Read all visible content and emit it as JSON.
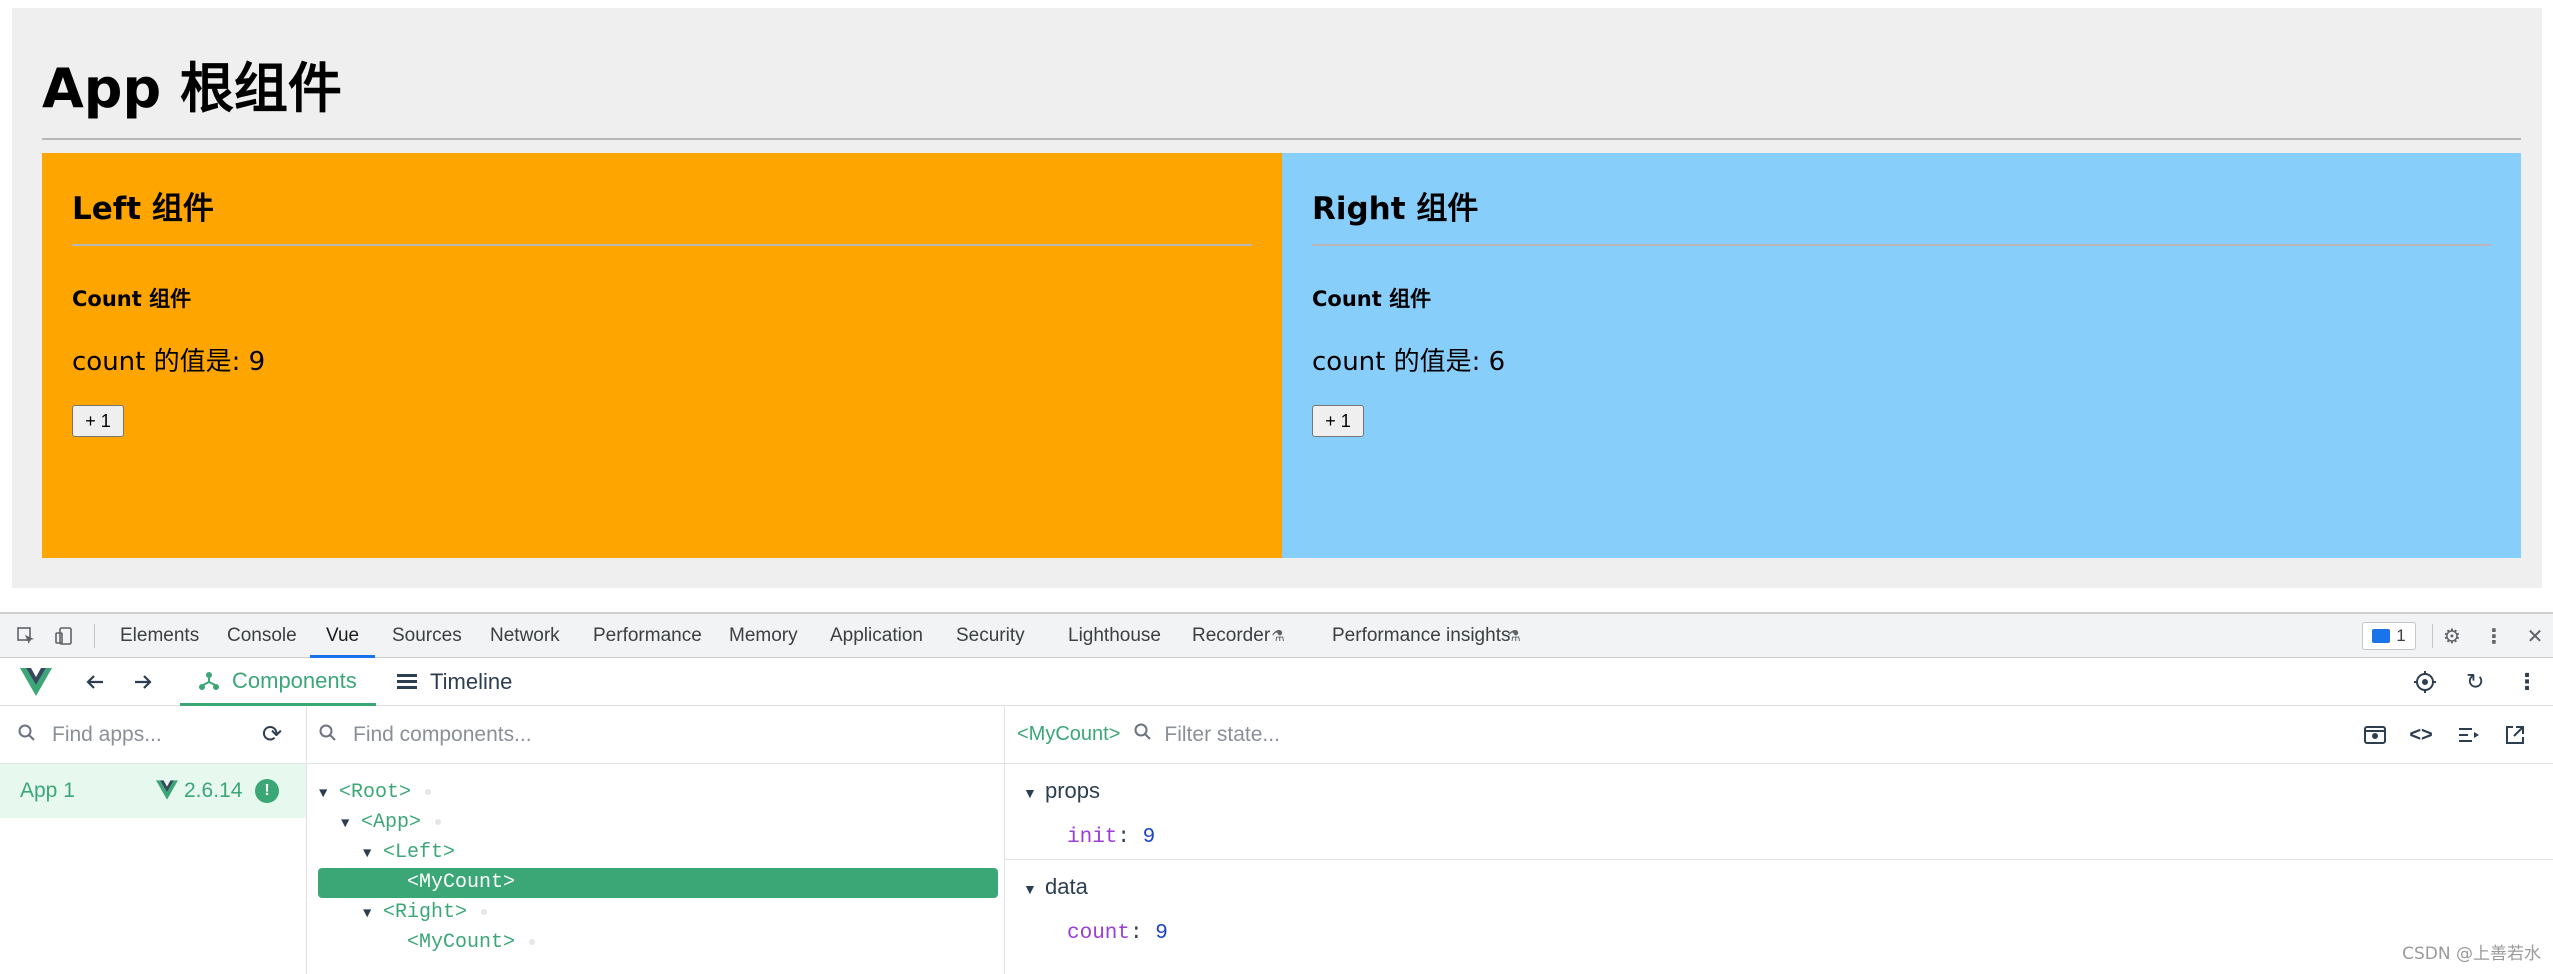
{
  "app": {
    "title": "App 根组件",
    "left": {
      "title": "Left 组件",
      "count_title": "Count 组件",
      "count_text": "count 的值是: 9",
      "button": "+ 1",
      "color": "#ffa500"
    },
    "right": {
      "title": "Right 组件",
      "count_title": "Count 组件",
      "count_text": "count 的值是: 6",
      "button": "+ 1",
      "color": "#87cefa"
    }
  },
  "devtools": {
    "tabs": [
      "Elements",
      "Console",
      "Vue",
      "Sources",
      "Network",
      "Performance",
      "Memory",
      "Application",
      "Security",
      "Lighthouse",
      "Recorder",
      "Performance insights"
    ],
    "active_tab": "Vue",
    "issues_count": "1",
    "vue": {
      "tab_components": "Components",
      "tab_timeline": "Timeline",
      "find_apps_placeholder": "Find apps...",
      "find_components_placeholder": "Find components...",
      "filter_state_placeholder": "Filter state...",
      "app_item": {
        "name": "App 1",
        "version": "2.6.14"
      },
      "tree": [
        "<Root>",
        "<App>",
        "<Left>",
        "<MyCount>",
        "<Right>",
        "<MyCount>"
      ],
      "selected_component": "<MyCount>",
      "state": {
        "props_title": "props",
        "props_key": "init",
        "props_value": "9",
        "data_title": "data",
        "data_key": "count",
        "data_value": "9"
      }
    },
    "accent_color": "#3ba776"
  },
  "watermark": "CSDN @上善若水"
}
